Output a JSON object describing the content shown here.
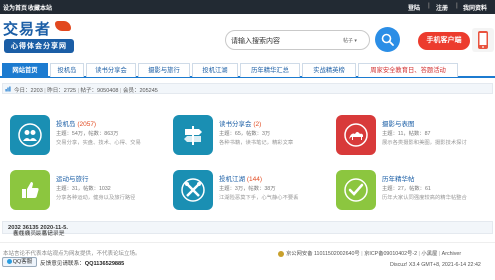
{
  "topbar": {
    "links": [
      "设为首页",
      "收藏本站"
    ],
    "login": "登陆",
    "register": "注册",
    "my_assets": "我同资料"
  },
  "header": {
    "logo_main": "交易者",
    "logo_sub": "心得体会分享网"
  },
  "search": {
    "placeholder": "请输入搜索内容",
    "type_label": "帖子 ▾"
  },
  "app_button": "手机客户端",
  "nav": {
    "items": [
      "网站首页",
      "投机岛",
      "读书分享会",
      "摄影与旅行",
      "投机江湖",
      "历年精华汇总",
      "实战精英榜",
      "周家安全教育日、答题活动"
    ]
  },
  "stats": {
    "today_label": "今日：",
    "today_value": "2203",
    "yesterday_label": "昨日：",
    "yesterday_value": "2725",
    "posts_label": "帖子：",
    "posts_value": "9050408",
    "members_label": "会员：",
    "members_value": "205245"
  },
  "forums": [
    {
      "name": "投机岛",
      "count": "(2057)",
      "stat": "主题：54万，帖数：863万",
      "desc": "交易分享，实盘、技术、心得、交易",
      "icon": "users-icon",
      "color": "#1a8fb3"
    },
    {
      "name": "读书分享会",
      "count": "(2)",
      "stat": "主题：65，帖数：3万",
      "desc": "各种书籍，读书笔记，精彩文章",
      "icon": "signpost-icon",
      "color": "#1a8fb3"
    },
    {
      "name": "摄影与表图",
      "count": "",
      "stat": "主题：11，帖数：87",
      "desc": "展示各类摄影和美图，摄影技术探讨",
      "icon": "camel-icon",
      "color": "#d83a3a"
    },
    {
      "name": "运动与旅行",
      "count": "",
      "stat": "主题：31，帖数：1032",
      "desc": "分享各种运动，健身以及旅行路径",
      "icon": "thumb-icon",
      "color": "#8cc63f"
    },
    {
      "name": "投机江湖",
      "count": "(144)",
      "stat": "主题：3万，帖数：38万",
      "desc": "江湖险恶莫下手，心气静心不要丢",
      "icon": "tools-icon",
      "color": "#1a8fb3"
    },
    {
      "name": "历年精华帖",
      "count": "",
      "stat": "主题：27，帖数：61",
      "desc": "历年大家认同强度较高的精华帖整合",
      "icon": "check-icon",
      "color": "#8cc63f"
    }
  ],
  "online": {
    "prefix": "在线会员 - 总计",
    "total": "2032",
    "middle": "人在线 - 最高记录是",
    "record": "36135",
    "record_at": "于",
    "record_date": "2020-11-5."
  },
  "footer": {
    "disclaimer": "本站言论不代表本站观点为网友提供，不代表论坛立场。",
    "police_record": "京公网安备 11011502002640号",
    "icp": "京ICP备09010402号-2",
    "mobile": "小黑屋",
    "archive": "Archiver",
    "qq_button": "QQ客服",
    "qq_prefix": "反馈意见请联系：",
    "qq_number": "QQ1136529885",
    "time": "Discuz! X3.4 GMT+8, 2021-6-14 22:42"
  }
}
